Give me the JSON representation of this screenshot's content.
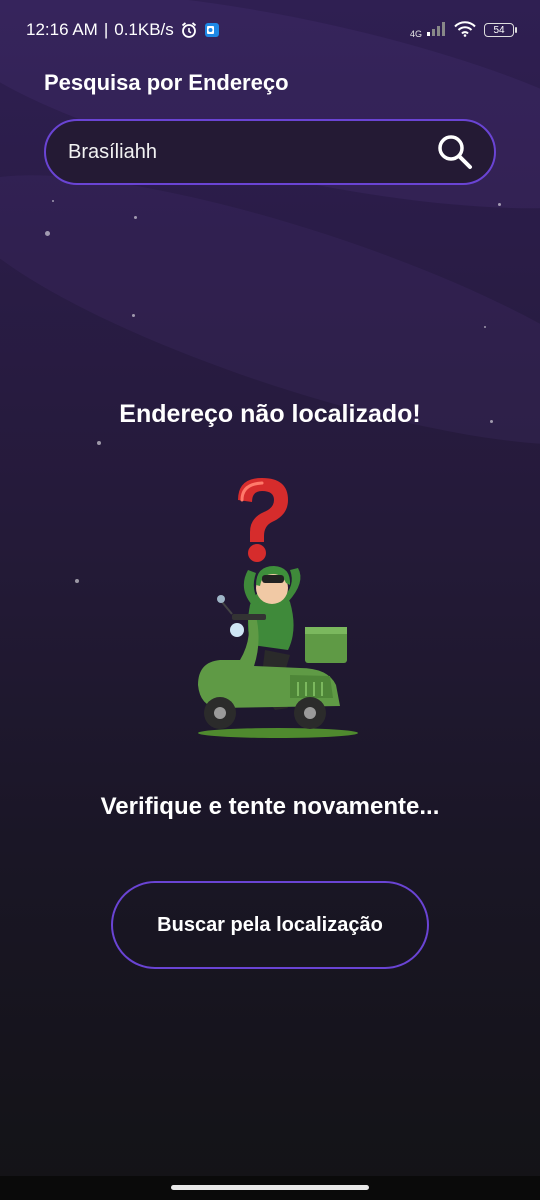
{
  "status_bar": {
    "time": "12:16 AM",
    "speed": "0.1KB/s",
    "separator": "|",
    "network": "4G",
    "battery": "54",
    "icons": [
      "alarm-icon",
      "outlook-app-icon",
      "signal-icon",
      "wifi-icon",
      "battery-icon"
    ]
  },
  "header": {
    "title": "Pesquisa por Endereço"
  },
  "search": {
    "value": "Brasíliahh",
    "placeholder": "",
    "icon": "search-icon"
  },
  "result": {
    "title": "Endereço não localizado!",
    "illustration": "confused-delivery-scooter-illustration",
    "subtitle": "Verifique e tente novamente..."
  },
  "actions": {
    "locate_label": "Buscar pela localização"
  },
  "colors": {
    "accent_border": "#6a44d4",
    "background_top": "#2f1f52",
    "background_bottom": "#131316",
    "question_mark": "#d62c2c",
    "scooter_green": "#5f9a45"
  }
}
